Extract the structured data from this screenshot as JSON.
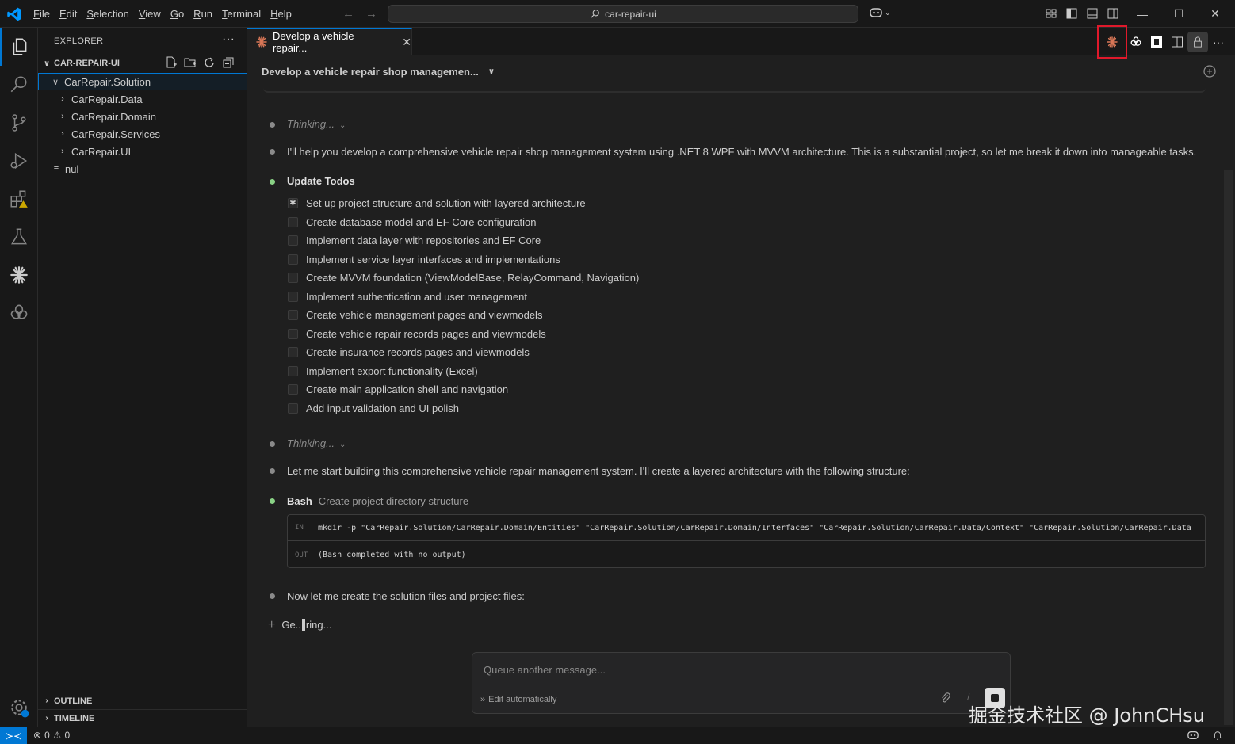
{
  "titlebar": {
    "menu": [
      "File",
      "Edit",
      "Selection",
      "View",
      "Go",
      "Run",
      "Terminal",
      "Help"
    ],
    "search": "car-repair-ui"
  },
  "sidebar": {
    "title": "EXPLORER",
    "more": "···",
    "root": "CAR-REPAIR-UI",
    "tree": [
      {
        "label": "CarRepair.Solution",
        "expanded": true
      },
      {
        "label": "CarRepair.Data"
      },
      {
        "label": "CarRepair.Domain"
      },
      {
        "label": "CarRepair.Services"
      },
      {
        "label": "CarRepair.UI"
      },
      {
        "label": "nul"
      }
    ],
    "outline": "OUTLINE",
    "timeline": "TIMELINE"
  },
  "editor": {
    "tab_label": "Develop a vehicle repair...",
    "chat_title": "Develop a vehicle repair shop managemen...",
    "thinking1": "Thinking...",
    "intro": "I'll help you develop a comprehensive vehicle repair shop management system using .NET 8 WPF with MVVM architecture. This is a substantial project, so let me break it down into manageable tasks.",
    "todo_title": "Update Todos",
    "todos": [
      "Set up project structure and solution with layered architecture",
      "Create database model and EF Core configuration",
      "Implement data layer with repositories and EF Core",
      "Implement service layer interfaces and implementations",
      "Create MVVM foundation (ViewModelBase, RelayCommand, Navigation)",
      "Implement authentication and user management",
      "Create vehicle management pages and viewmodels",
      "Create vehicle repair records pages and viewmodels",
      "Create insurance records pages and viewmodels",
      "Implement export functionality (Excel)",
      "Create main application shell and navigation",
      "Add input validation and UI polish"
    ],
    "thinking2": "Thinking...",
    "message2": "Let me start building this comprehensive vehicle repair management system. I'll create a layered architecture with the following structure:",
    "bash_label": "Bash",
    "bash_desc": "Create project directory structure",
    "bash_in_tag": "IN",
    "bash_in": "mkdir -p \"CarRepair.Solution/CarRepair.Domain/Entities\" \"CarRepair.Solution/CarRepair.Domain/Interfaces\" \"CarRepair.Solution/CarRepair.Data/Context\" \"CarRepair.Solution/CarRepair.Data",
    "bash_out_tag": "OUT",
    "bash_out": "(Bash completed with no output)",
    "message3": "Now let me create the solution files and project files:",
    "working_pre": "Ge..",
    "working_post": "ring...",
    "input_placeholder": "Queue another message...",
    "mode": "Edit automatically",
    "slash": "/"
  },
  "watermark": "掘金技术社区 @ JohnCHsu",
  "statusbar": {
    "errors": "0",
    "warnings": "0"
  },
  "colors": {
    "accent": "#0078d4",
    "highlight_box": "#e0192b",
    "claude_orange": "#d97757",
    "todo_dot": "#89d185"
  }
}
